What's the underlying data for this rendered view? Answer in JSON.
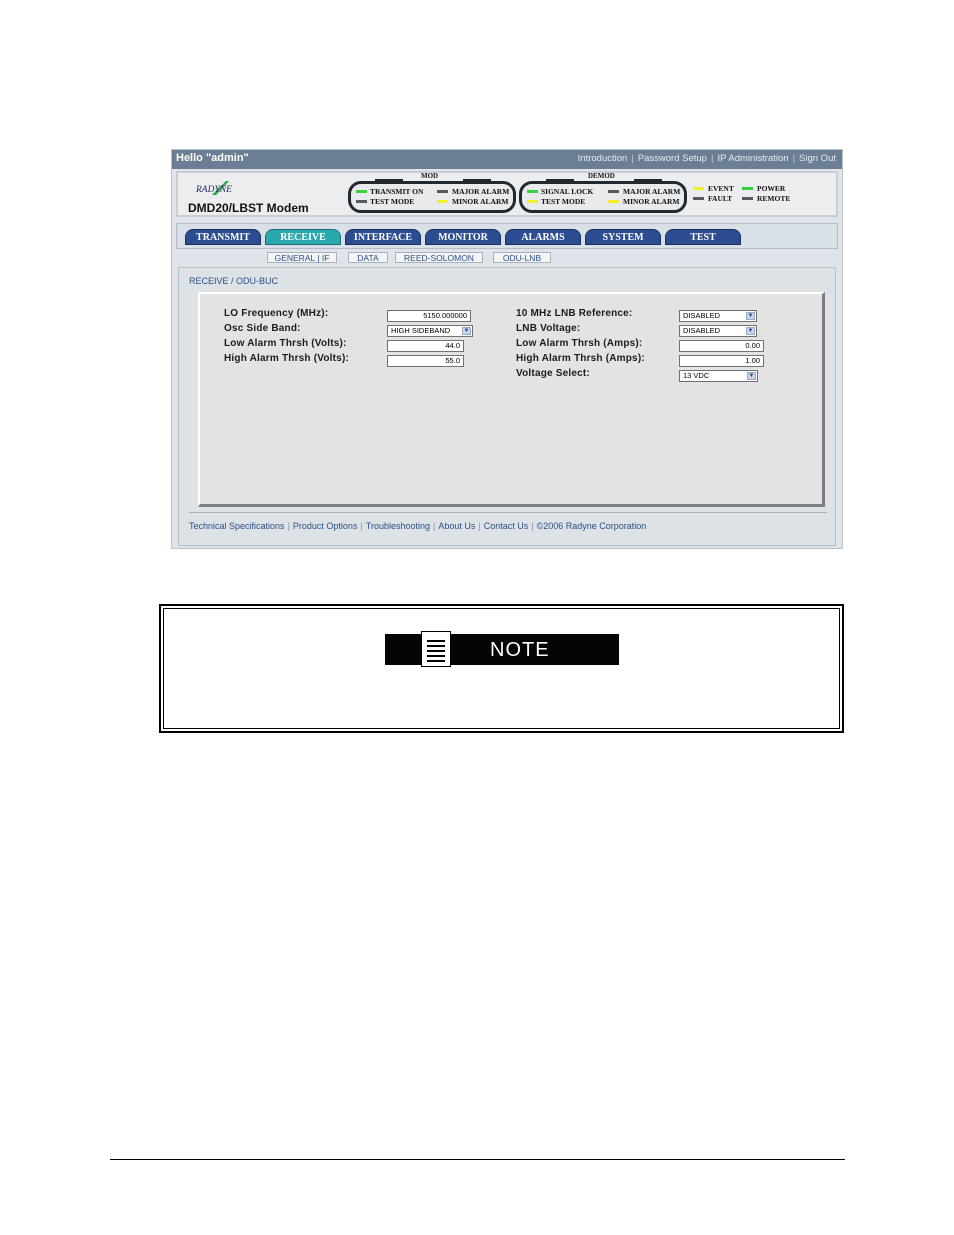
{
  "topbar": {
    "greeting": "Hello \"admin\"",
    "links": [
      "Introduction",
      "Password Setup",
      "IP Administration",
      "Sign Out"
    ],
    "separator": "|"
  },
  "header": {
    "logo_text": "RADYNE",
    "modem_name": "DMD20/LBST Modem",
    "mod_group": {
      "label": "MOD",
      "leds": [
        {
          "label": "TRANSMIT ON",
          "color": "green"
        },
        {
          "label": "TEST MODE",
          "color": "dark"
        },
        {
          "label": "MAJOR ALARM",
          "color": "dark"
        },
        {
          "label": "MINOR ALARM",
          "color": "yellow"
        }
      ]
    },
    "demod_group": {
      "label": "DEMOD",
      "leds": [
        {
          "label": "SIGNAL LOCK",
          "color": "green"
        },
        {
          "label": "TEST MODE",
          "color": "yellow"
        },
        {
          "label": "MAJOR ALARM",
          "color": "dark"
        },
        {
          "label": "MINOR ALARM",
          "color": "yellow"
        }
      ]
    },
    "status_leds": [
      {
        "label": "EVENT",
        "color": "yellow"
      },
      {
        "label": "FAULT",
        "color": "dark"
      },
      {
        "label": "POWER",
        "color": "green"
      },
      {
        "label": "REMOTE",
        "color": "dark"
      }
    ]
  },
  "nav": {
    "tabs": [
      "TRANSMIT",
      "RECEIVE",
      "INTERFACE",
      "MONITOR",
      "ALARMS",
      "SYSTEM",
      "TEST"
    ],
    "active_tab": "RECEIVE"
  },
  "subnav": {
    "tabs": [
      "GENERAL | IF",
      "DATA",
      "REED-SOLOMON",
      "ODU-LNB"
    ]
  },
  "breadcrumb": "RECEIVE / ODU-BUC",
  "form": {
    "left": {
      "lo_frequency": {
        "label": "LO Frequency (MHz):",
        "value": "5150.000000"
      },
      "osc_side_band": {
        "label": "Osc Side Band:",
        "value": "HIGH SIDEBAND"
      },
      "low_alarm_volts": {
        "label": "Low Alarm Thrsh (Volts):",
        "value": "44.0"
      },
      "high_alarm_volts": {
        "label": "High Alarm Thrsh (Volts):",
        "value": "55.0"
      }
    },
    "right": {
      "lnb_reference": {
        "label": "10 MHz LNB Reference:",
        "value": "DISABLED"
      },
      "lnb_voltage": {
        "label": "LNB Voltage:",
        "value": "DISABLED"
      },
      "low_alarm_amps": {
        "label": "Low Alarm Thrsh (Amps):",
        "value": "0.00"
      },
      "high_alarm_amps": {
        "label": "High Alarm Thrsh (Amps):",
        "value": "1.00"
      },
      "voltage_select": {
        "label": "Voltage Select:",
        "value": "13 VDC"
      }
    }
  },
  "footer": {
    "links": [
      "Technical Specifications",
      "Product Options",
      "Troubleshooting",
      "About Us",
      "Contact Us"
    ],
    "copyright": "©2006 Radyne Corporation",
    "separator": "|"
  },
  "note": {
    "label": "NOTE"
  },
  "colors": {
    "tab": "#2d4d93",
    "tab_active": "#2aa9ac",
    "led_green": "#38d13e",
    "led_yellow": "#f4ee29",
    "led_dark": "#545a60",
    "link": "#2a4f86"
  }
}
